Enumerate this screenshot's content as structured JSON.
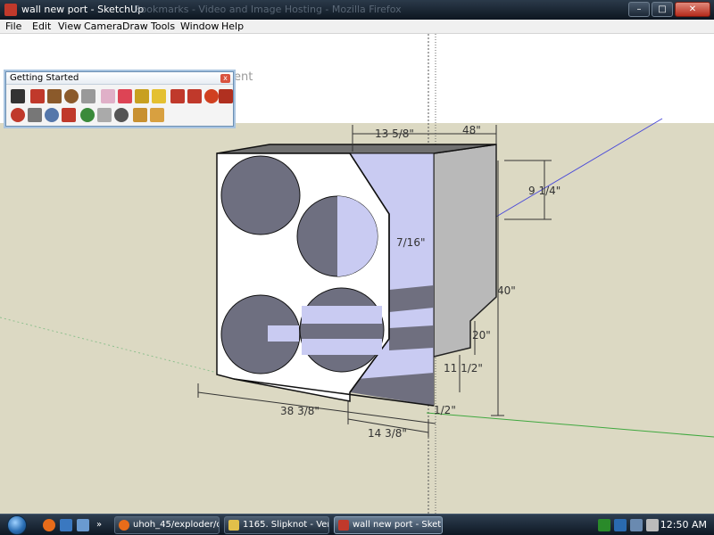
{
  "window": {
    "title": "wall new port - SketchUp",
    "faded_title": "Bookmarks - Video and Image Hosting - Mozilla Firefox",
    "buttons": {
      "minimize": "–",
      "maximize": "□",
      "close": "✕"
    }
  },
  "menu": [
    "File",
    "Edit",
    "View",
    "Camera",
    "Draw",
    "Tools",
    "Window",
    "Help"
  ],
  "toolbar": {
    "title": "Getting Started",
    "close": "x",
    "row1": [
      "select-tool",
      "pencil-tool",
      "rectangle-tool",
      "circle-tool",
      "arc-tool",
      "eraser-tool",
      "paint-bucket-tool",
      "tape-measure-tool",
      "push-pull-tool",
      "move-tool",
      "offset-tool",
      "rotate-tool",
      "follow-me-tool"
    ],
    "row2": [
      "orbit-tool",
      "pan-tool",
      "zoom-tool",
      "zoom-extents-tool",
      "get-models-tool",
      "share-model-tool",
      "geo-location-tool",
      "component-tool",
      "material-tool"
    ]
  },
  "viewport": {
    "ghost_text": "ent",
    "dimensions": {
      "top_inner": "13 5/8\"",
      "top_outer": "48\"",
      "right_upper": "9 1/4\"",
      "port_width": "7/16\"",
      "height_total": "40\"",
      "port_height": "20\"",
      "port_depth": "11 1/2\"",
      "bottom_small": "1/2\"",
      "width_front": "38 3/8\"",
      "width_bottom": "14 3/8\""
    }
  },
  "taskbar": {
    "tasks": [
      {
        "label": "uhoh_45/exploder/d...",
        "icon_color": "#e86c1a"
      },
      {
        "label": "1165. Slipknot - Ver...",
        "icon_color": "#e2c04a"
      },
      {
        "label": "wall new port - Sket...",
        "icon_color": "#c0392b"
      }
    ],
    "clock": "12:50 AM"
  },
  "colors": {
    "ground": "#dcd9c3",
    "box_front": "#ffffff",
    "box_side": "#b8b8b8",
    "box_top": "#6e6e6e",
    "port_light": "#c9cbf2",
    "speaker_hole": "#6e6f80"
  }
}
